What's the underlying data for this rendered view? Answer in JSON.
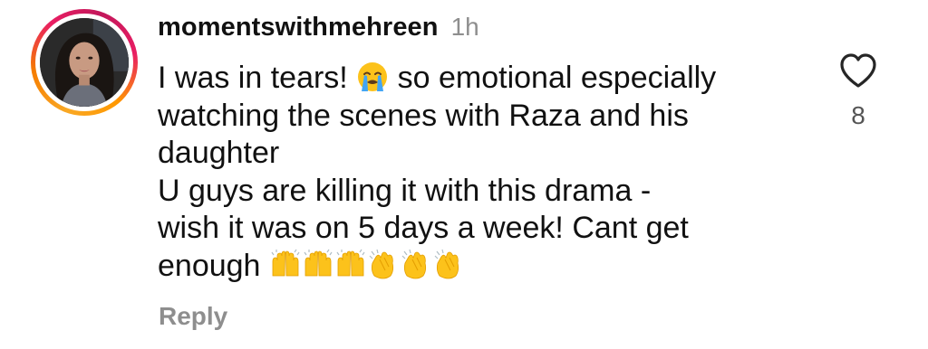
{
  "comment": {
    "username": "momentswithmehreen",
    "time": "1h",
    "lines": [
      "I was in tears! ",
      " so emotional especially",
      "watching the scenes with Raza and his",
      "daughter",
      "U guys are killing it with this drama -",
      "wish it was on 5 days a week! Cant get",
      "enough "
    ],
    "emojis": {
      "tears": "loudly-crying-face",
      "raised_hands": "raising-hands",
      "clap": "clapping-hands"
    },
    "reply_label": "Reply",
    "like_count": "8",
    "like_icon": "heart-outline-icon"
  },
  "colors": {
    "text": "#111111",
    "muted": "#8e8e8e",
    "ring_start": "#f9a825",
    "ring_end": "#e91e63"
  }
}
